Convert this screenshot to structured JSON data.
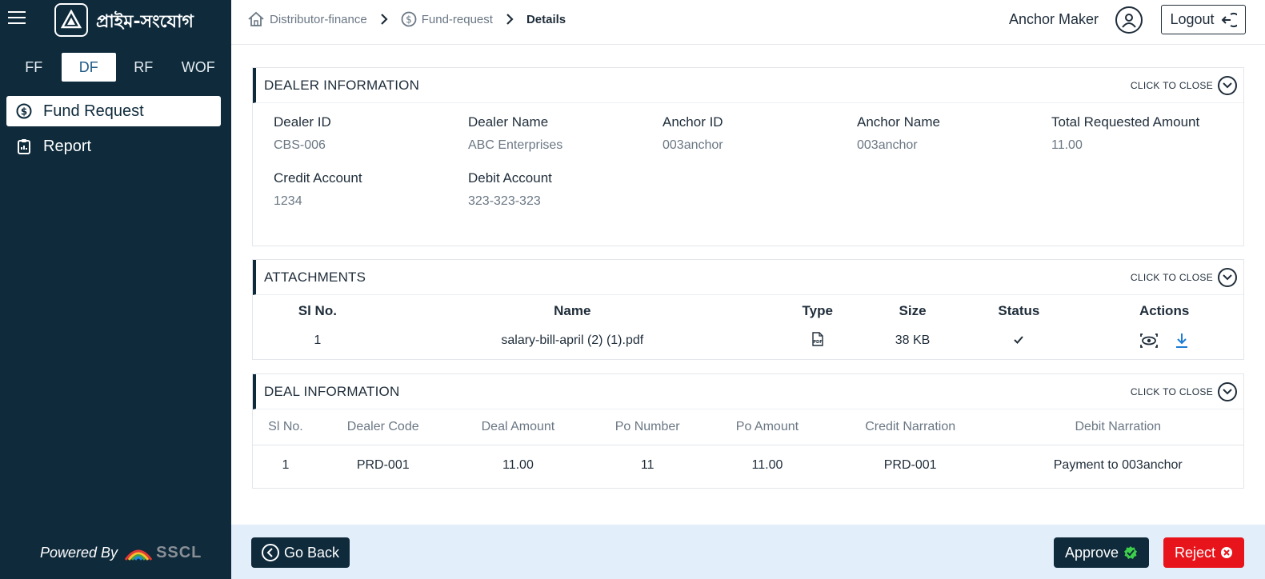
{
  "app": {
    "brand": "প্রাইম-সংযোগ"
  },
  "sidebar": {
    "tabs": [
      {
        "label": "FF",
        "active": false
      },
      {
        "label": "DF",
        "active": true
      },
      {
        "label": "RF",
        "active": false
      },
      {
        "label": "WOF",
        "active": false
      }
    ],
    "items": [
      {
        "label": "Fund Request",
        "icon": "dollar-circle-icon",
        "active": true
      },
      {
        "label": "Report",
        "icon": "clipboard-icon",
        "active": false
      }
    ],
    "powered_by": "Powered By",
    "powered_logo": "SSCL"
  },
  "header": {
    "breadcrumbs": [
      {
        "label": "Distributor-finance",
        "icon": "home-icon"
      },
      {
        "label": "Fund-request",
        "icon": "dollar-circle-icon"
      },
      {
        "label": "Details"
      }
    ],
    "user_name": "Anchor Maker",
    "logout_label": "Logout"
  },
  "dealer_info": {
    "title": "DEALER INFORMATION",
    "toggle_label": "CLICK TO CLOSE",
    "fields": [
      {
        "label": "Dealer ID",
        "value": "CBS-006"
      },
      {
        "label": "Dealer Name",
        "value": "ABC Enterprises"
      },
      {
        "label": "Anchor ID",
        "value": "003anchor"
      },
      {
        "label": "Anchor Name",
        "value": "003anchor"
      },
      {
        "label": "Total Requested Amount",
        "value": "11.00"
      },
      {
        "label": "Credit Account",
        "value": "1234"
      },
      {
        "label": "Debit Account",
        "value": "323-323-323"
      }
    ]
  },
  "attachments": {
    "title": "ATTACHMENTS",
    "toggle_label": "CLICK TO CLOSE",
    "columns": [
      "Sl No.",
      "Name",
      "Type",
      "Size",
      "Status",
      "Actions"
    ],
    "rows": [
      {
        "sl": "1",
        "name": "salary-bill-april (2) (1).pdf",
        "type_icon": "pdf-icon",
        "size": "38 KB",
        "status_icon": "check-icon",
        "actions": [
          "view-icon",
          "download-icon"
        ]
      }
    ]
  },
  "deal_info": {
    "title": "DEAL INFORMATION",
    "toggle_label": "CLICK TO CLOSE",
    "columns": [
      "Sl No.",
      "Dealer Code",
      "Deal Amount",
      "Po Number",
      "Po Amount",
      "Credit Narration",
      "Debit Narration"
    ],
    "rows": [
      {
        "sl": "1",
        "dealer_code": "PRD-001",
        "deal_amount": "11.00",
        "po_number": "11",
        "po_amount": "11.00",
        "credit_narration": "PRD-001",
        "debit_narration": "Payment to 003anchor"
      }
    ]
  },
  "footer": {
    "back_label": "Go Back",
    "approve_label": "Approve",
    "reject_label": "Reject"
  },
  "colors": {
    "sidebar_bg": "#0e2a3b",
    "footer_bg": "#e2eef9",
    "reject": "#e8141b",
    "approve_check": "#3ecf4a",
    "download": "#1c7cd6"
  }
}
